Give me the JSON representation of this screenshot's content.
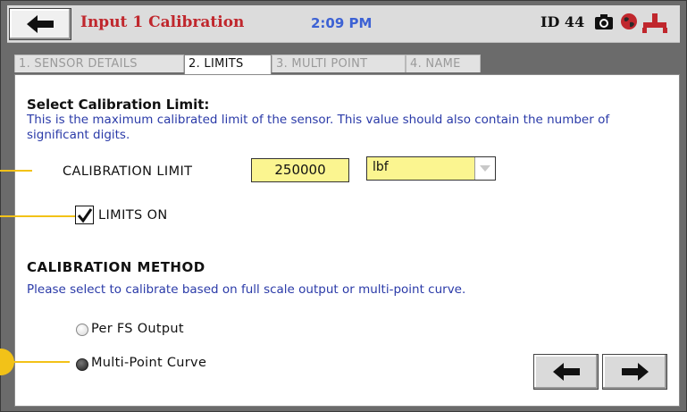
{
  "header": {
    "title": "Input 1 Calibration",
    "time": "2:09 PM",
    "device_id": "ID 44",
    "icons": [
      "back-arrow-icon",
      "camera-icon",
      "globe-icon",
      "connector-icon"
    ]
  },
  "tabs": [
    {
      "label": "1. SENSOR DETAILS",
      "active": false
    },
    {
      "label": "2. LIMITS",
      "active": true
    },
    {
      "label": "3. MULTI POINT",
      "active": false
    },
    {
      "label": "4. NAME",
      "active": false
    }
  ],
  "limit_section": {
    "heading": "Select Calibration Limit:",
    "description": "This is the maximum calibrated limit of the sensor.  This value should also contain the number of significant digits.",
    "field_label": "CALIBRATION LIMIT",
    "value": "250000",
    "unit": "lbf",
    "limits_on_label": "LIMITS ON",
    "limits_on": true
  },
  "method_section": {
    "heading": "CALIBRATION METHOD",
    "description": "Please select to calibrate based on full scale output or multi-point curve.",
    "options": [
      {
        "label": "Per FS Output",
        "selected": false
      },
      {
        "label": "Multi-Point Curve",
        "selected": true
      }
    ]
  },
  "colors": {
    "title": "#c0272d",
    "time": "#3d62d4",
    "description": "#2a3aa8",
    "input_fill": "#fbf590",
    "callout": "#f2c218"
  }
}
